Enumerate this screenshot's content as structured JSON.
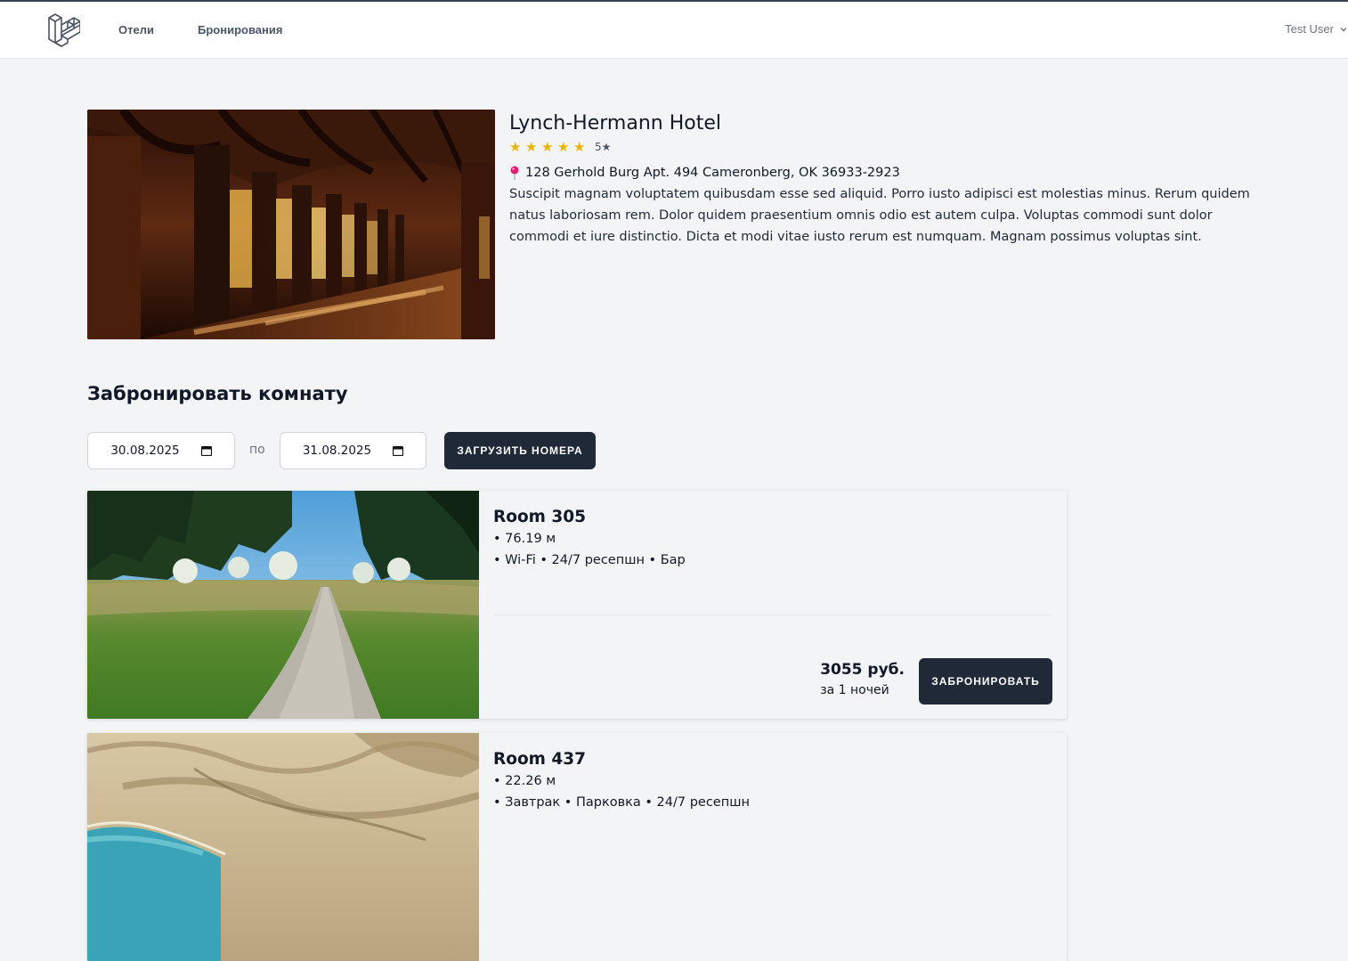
{
  "nav": {
    "links": [
      "Отели",
      "Бронирования"
    ],
    "user": "Test User"
  },
  "hotel": {
    "name": "Lynch-Hermann Hotel",
    "stars": 5,
    "rating_label": "5★",
    "address": "128 Gerhold Burg Apt. 494 Cameronberg, OK 36933-2923",
    "description": "Suscipit magnam voluptatem quibusdam esse sed aliquid. Porro iusto adipisci est molestias minus. Rerum quidem natus laboriosam rem. Dolor quidem praesentium omnis odio est autem culpa. Voluptas commodi sunt dolor commodi et iure distinctio. Dicta et modi vitae iusto rerum est numquam. Magnam possimus voluptas sint."
  },
  "booking": {
    "title": "Забронировать комнату",
    "date_from": "30.08.2025",
    "separator": "по",
    "date_to": "31.08.2025",
    "load_button": "Загрузить номера"
  },
  "rooms": [
    {
      "title": "Room 305",
      "area": "• 76.19 м",
      "amenities": "• Wi-Fi • 24/7 ресепшн • Бар",
      "price": "3055 руб.",
      "per": "за 1 ночей",
      "book_button": "Забронировать"
    },
    {
      "title": "Room 437",
      "area": "• 22.26 м",
      "amenities": "• Завтрак • Парковка • 24/7 ресепшн"
    }
  ],
  "colors": {
    "page_bg": "#f3f4f6",
    "button_bg": "#1f2937",
    "star": "#eab308",
    "pin": "#e11d74"
  }
}
